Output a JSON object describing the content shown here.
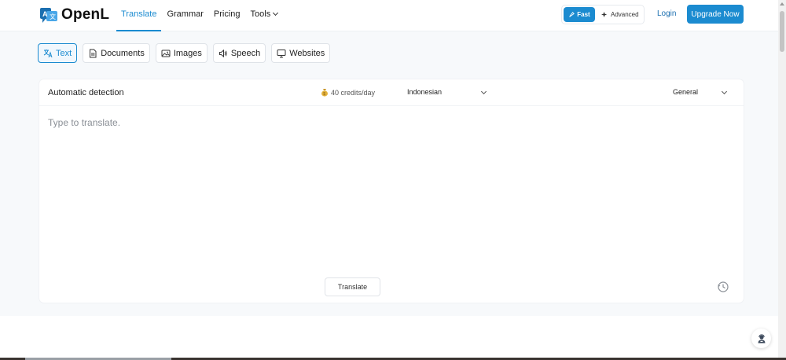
{
  "header": {
    "logo_text": "OpenL",
    "nav": [
      {
        "label": "Translate",
        "active": true
      },
      {
        "label": "Grammar"
      },
      {
        "label": "Pricing"
      },
      {
        "label": "Tools"
      }
    ],
    "mode_fast": "Fast",
    "mode_advanced": "Advanced",
    "login": "Login",
    "upgrade": "Upgrade Now"
  },
  "modes": [
    {
      "label": "Text",
      "icon": "translate-icon",
      "active": true
    },
    {
      "label": "Documents",
      "icon": "document-icon"
    },
    {
      "label": "Images",
      "icon": "image-icon"
    },
    {
      "label": "Speech",
      "icon": "speaker-icon"
    },
    {
      "label": "Websites",
      "icon": "monitor-icon"
    }
  ],
  "translator": {
    "source_language": "Automatic detection",
    "credits": "40 credits/day",
    "target_language": "Indonesian",
    "style": "General",
    "placeholder": "Type to translate.",
    "translate_button": "Translate"
  },
  "colors": {
    "accent": "#1b8bd0",
    "background": "#f7f9fb"
  }
}
